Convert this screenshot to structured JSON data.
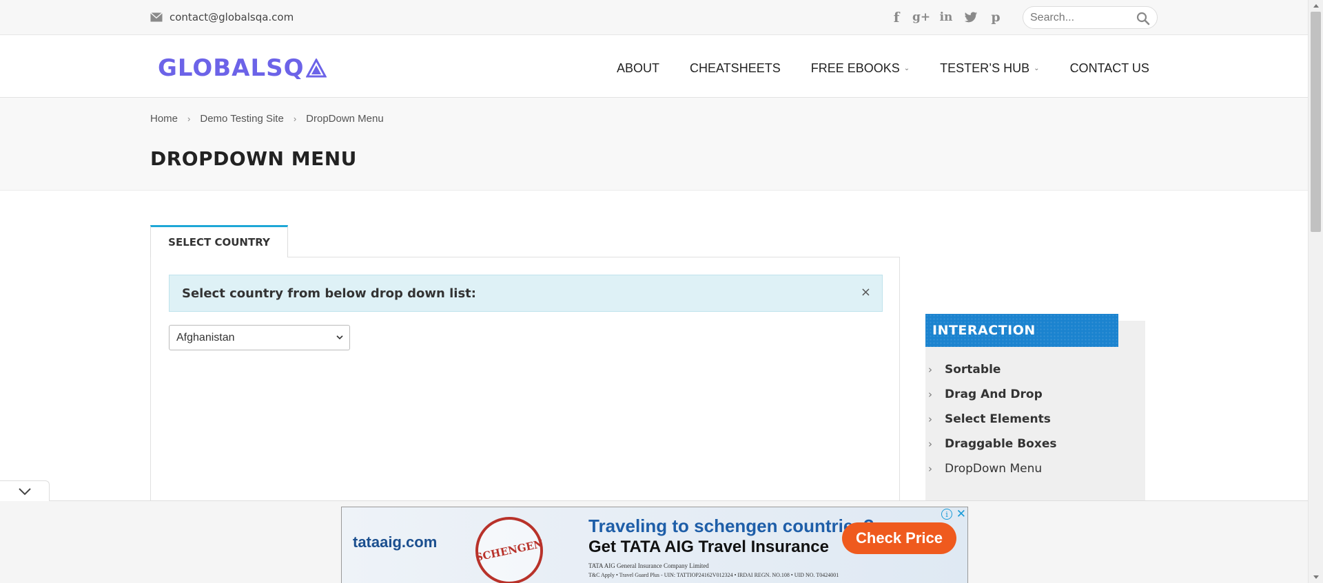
{
  "topbar": {
    "email": "contact@globalsqa.com",
    "social_icons": [
      "facebook-icon",
      "google-plus-icon",
      "linkedin-icon",
      "twitter-icon",
      "pinterest-icon"
    ],
    "social_glyphs": {
      "facebook": "f",
      "google_plus": "g+",
      "linkedin": "in",
      "pinterest": "p"
    },
    "search_placeholder": "Search..."
  },
  "header": {
    "logo_text": "GLOBALSQ",
    "logo_color": "#6c63e8",
    "nav": [
      {
        "label": "ABOUT",
        "has_dropdown": false
      },
      {
        "label": "CHEATSHEETS",
        "has_dropdown": false
      },
      {
        "label": "FREE EBOOKS",
        "has_dropdown": true
      },
      {
        "label": "TESTER’S HUB",
        "has_dropdown": true
      },
      {
        "label": "CONTACT US",
        "has_dropdown": false
      }
    ]
  },
  "breadcrumb": [
    "Home",
    "Demo Testing Site",
    "DropDown Menu"
  ],
  "page_title": "DROPDOWN MENU",
  "tab": {
    "label": "SELECT COUNTRY",
    "accent": "#1ea7d6"
  },
  "alert": {
    "text": "Select country from below drop down list:",
    "close": "×",
    "bg": "#def1f6"
  },
  "country_select": {
    "selected": "Afghanistan"
  },
  "sidebar": {
    "heading": "INTERACTION",
    "heading_bg": "#1b83cf",
    "items": [
      {
        "label": "Sortable",
        "bold": true
      },
      {
        "label": "Drag And Drop",
        "bold": true
      },
      {
        "label": "Select Elements",
        "bold": true
      },
      {
        "label": "Draggable Boxes",
        "bold": true
      },
      {
        "label": "DropDown Menu",
        "bold": false
      }
    ]
  },
  "ad": {
    "brand": "tataaig.com",
    "stamp": "SCHENGEN",
    "headline1": "Traveling to schengen countries?",
    "headline2": "Get TATA AIG Travel Insurance",
    "fine1": "TATA AIG General Insurance Company Limited",
    "fine2": "T&C Apply • Travel Guard Plus - UIN: TATTIOP24162V012324 • IRDAI REGN. NO.108 • UID NO. T0424001",
    "cta": "Check Price",
    "cta_color": "#ef5a1e",
    "info": "i",
    "close": "✕"
  }
}
